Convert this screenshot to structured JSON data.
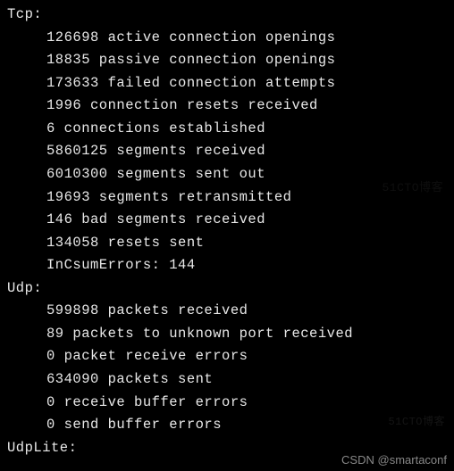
{
  "sections": {
    "tcp": {
      "header": "Tcp:",
      "lines": [
        "126698 active connection openings",
        "18835 passive connection openings",
        "173633 failed connection attempts",
        "1996 connection resets received",
        "6 connections established",
        "5860125 segments received",
        "6010300 segments sent out",
        "19693 segments retransmitted",
        "146 bad segments received",
        "134058 resets sent",
        "InCsumErrors: 144"
      ]
    },
    "udp": {
      "header": "Udp:",
      "lines": [
        "599898 packets received",
        "89 packets to unknown port received",
        "0 packet receive errors",
        "634090 packets sent",
        "0 receive buffer errors",
        "0 send buffer errors"
      ]
    },
    "udplite": {
      "header": "UdpLite:"
    }
  },
  "watermarks": {
    "top": "51CTO博客",
    "bottom": "51CTO博客"
  },
  "footer": "CSDN @smartaconf"
}
